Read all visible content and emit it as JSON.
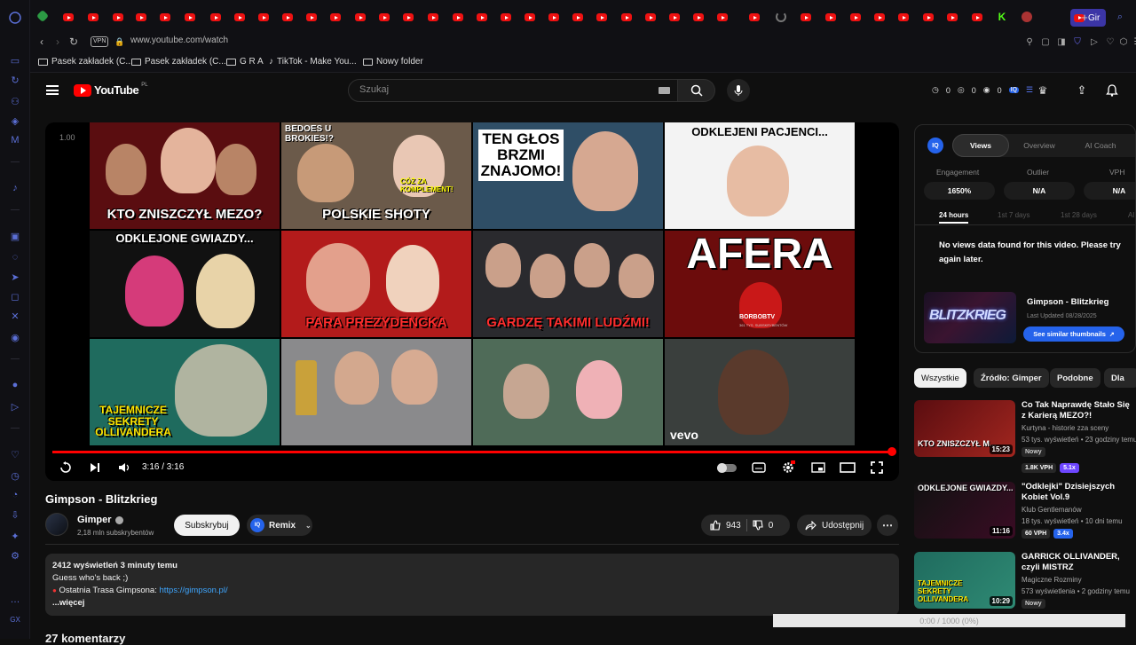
{
  "browser": {
    "url": "www.youtube.com/watch",
    "vpn_label": "VPN",
    "active_tab_label": "Gir",
    "bookmarks": [
      {
        "label": "Pasek zakładek (C..."
      },
      {
        "label": "Pasek zakładek (C..."
      },
      {
        "label": "G R A"
      },
      {
        "label": "TikTok - Make You..."
      },
      {
        "label": "Nowy folder"
      }
    ]
  },
  "header": {
    "logo_text": "YouTube",
    "logo_country": "PL",
    "search_placeholder": "Szukaj",
    "stats": [
      "0",
      "0",
      "0"
    ]
  },
  "player": {
    "speed_label": "1.00",
    "time": "3:16 / 3:16",
    "progress": 1.0,
    "watermark": "vevo",
    "end_screen": [
      {
        "title": "KTO ZNISZCZYŁ MEZO?",
        "bg": "#5a0d10"
      },
      {
        "title": "POLSKIE SHOTY",
        "bg": "#6b5a4a",
        "top": "BEDOES U BROKIES!?",
        "side": "CÓŻ ZA KOMPLEMENT!"
      },
      {
        "title": "TEN GŁOS BRZMI ZNAJOMO!",
        "bg": "#2f4e66"
      },
      {
        "title": "ODKLEJENI PACJENCI...",
        "bg": "#f3f3f3"
      },
      {
        "title": "ODKLEJONE GWIAZDY...",
        "bg": "#111111"
      },
      {
        "title": "PARA PREZYDENCKA",
        "bg": "#b31b1b"
      },
      {
        "title": "GARDZĘ TAKIMI LUDŹMI!",
        "bg": "#2a2a2e"
      },
      {
        "title": "AFERA",
        "bg": "#6c0c0c",
        "sub": "BORBOBTV",
        "sub2": "361 TYS. SUBSKRYBENTÓW"
      },
      {
        "title": "TAJEMNICZE SEKRETY OLLIVANDERA",
        "bg": "#1f6b5e"
      },
      {
        "title": "",
        "bg": "#8a8a8c"
      },
      {
        "title": "",
        "bg": "#4f6b58"
      },
      {
        "title": "",
        "bg": "#3a3f3d"
      }
    ]
  },
  "video": {
    "title": "Gimpson - Blitzkrieg",
    "channel": "Gimper",
    "subscribers": "2,18 mln subskrybentów",
    "subscribe_label": "Subskrybuj",
    "remix_label": "Remix",
    "likes": "943",
    "dislikes": "0",
    "share_label": "Udostępnij",
    "description": {
      "stats": "2412 wyświetleń  3 minuty temu",
      "line1": "Guess who's back ;)",
      "line2_prefix": "Ostatnia Trasa Gimpsona: ",
      "line2_link": "https://gimpson.pl/",
      "more": "...więcej"
    },
    "comments_peek": "27 komentarzy"
  },
  "extension": {
    "logo": "IQ",
    "tabs": [
      "Views",
      "Overview",
      "AI Coach"
    ],
    "metrics": [
      {
        "label": "Engagement",
        "value": "1650%"
      },
      {
        "label": "Outlier",
        "value": "N/A"
      },
      {
        "label": "VPH",
        "value": "N/A"
      }
    ],
    "ranges": [
      "24 hours",
      "1st 7 days",
      "1st 28 days",
      "Al"
    ],
    "no_data": "No views data found for this video. Please try again later.",
    "thumb_text": "BLITZKRIEG",
    "video_title": "Gimpson - Blitzkrieg",
    "last_updated": "Last Updated 08/28/2025",
    "similar_label": "See similar thumbnails"
  },
  "chips": [
    "Wszystkie",
    "Źródło: Gimper",
    "Podobne",
    "Dla"
  ],
  "recommendations": [
    {
      "title": "Co Tak Naprawdę Stało Się z Karierą MEZO?!",
      "channel": "Kurtyna - historie zza sceny",
      "meta": "53 tys. wyświetleń • 23 godziny temu",
      "badge": "Nowy",
      "vph": "1.8K VPH",
      "mult": "5.1x",
      "mult_color": "purple",
      "duration": "15:23",
      "thumb_text": "KTO ZNISZCZYŁ M..."
    },
    {
      "title": "\"Odklejki\" Dzisiejszych Kobiet Vol.9",
      "channel": "Klub Gentlemanów",
      "meta": "18 tys. wyświetleń • 10 dni temu",
      "badge": "",
      "vph": "60 VPH",
      "mult": "3.4x",
      "mult_color": "blue",
      "duration": "11:16",
      "thumb_text": "ODKLEJONE GWIAZDY..."
    },
    {
      "title": "GARRICK OLLIVANDER, czyli MISTRZ RÓŻDŻKARSTWA ...",
      "channel": "Magiczne Rozminy",
      "meta": "573 wyświetlenia • 2 godziny temu",
      "badge": "Nowy",
      "vph": "",
      "mult": "",
      "mult_color": "",
      "duration": "10:29",
      "thumb_text": "TAJEMNICZE SEKRETY OLLIVANDERA"
    }
  ],
  "timeline_overlay": "0:00 / 1000 (0%)"
}
